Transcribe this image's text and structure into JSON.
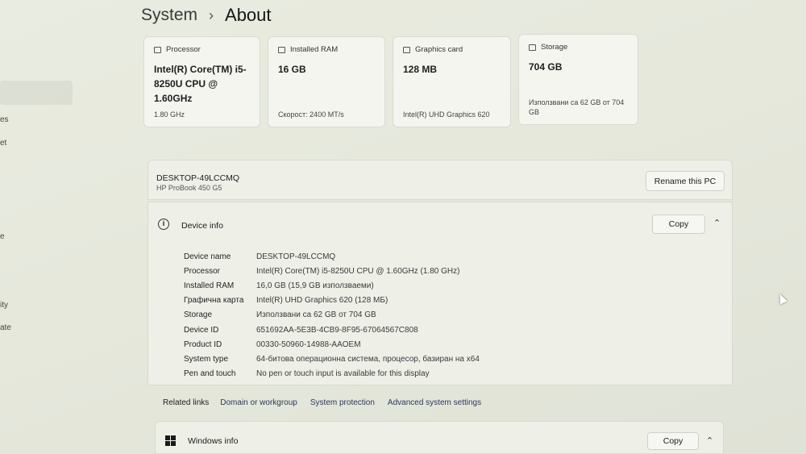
{
  "breadcrumb": {
    "parent": "System",
    "separator": "›",
    "current": "About"
  },
  "sidebar_fragments": [
    "es",
    "et",
    "e",
    "ity",
    "ate"
  ],
  "cards": [
    {
      "label": "Processor",
      "icon": "processor-icon",
      "value": "Intel(R) Core(TM) i5-8250U CPU @ 1.60GHz",
      "sub": "1.80 GHz"
    },
    {
      "label": "Installed RAM",
      "icon": "ram-icon",
      "value": "16 GB",
      "sub": "Скорост: 2400 MT/s"
    },
    {
      "label": "Graphics card",
      "icon": "graphics-card-icon",
      "value": "128 MB",
      "sub": "Intel(R) UHD Graphics 620"
    },
    {
      "label": "Storage",
      "icon": "storage-icon",
      "value": "704 GB",
      "sub": "Използвани са 62 GB от 704 GB"
    }
  ],
  "pc": {
    "name": "DESKTOP-49LCCMQ",
    "model": "HP ProBook 450 G5",
    "rename_label": "Rename this PC"
  },
  "device_info": {
    "title": "Device info",
    "copy_label": "Copy",
    "rows": [
      {
        "label": "Device name",
        "value": "DESKTOP-49LCCMQ"
      },
      {
        "label": "Processor",
        "value": "Intel(R) Core(TM) i5-8250U CPU @ 1.60GHz (1.80 GHz)"
      },
      {
        "label": "Installed RAM",
        "value": "16,0 GB (15,9 GB използваеми)"
      },
      {
        "label": "Графична карта",
        "value": "Intel(R) UHD Graphics 620 (128 МБ)"
      },
      {
        "label": "Storage",
        "value": "Използвани са 62 GB от 704 GB"
      },
      {
        "label": "Device ID",
        "value": "651692AA-5E3B-4CB9-8F95-67064567C808"
      },
      {
        "label": "Product ID",
        "value": "00330-50960-14988-AAOEM"
      },
      {
        "label": "System type",
        "value": "64-битова операционна система, процесор, базиран на x64"
      },
      {
        "label": "Pen and touch",
        "value": "No pen or touch input is available for this display"
      }
    ]
  },
  "related": {
    "label": "Related links",
    "links": [
      "Domain or workgroup",
      "System protection",
      "Advanced system settings"
    ]
  },
  "windows_info": {
    "title": "Windows info",
    "copy_label": "Copy"
  }
}
